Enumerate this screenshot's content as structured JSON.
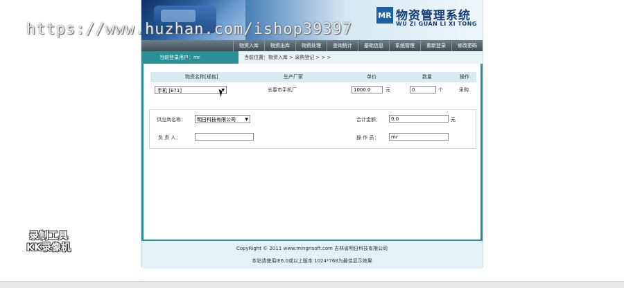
{
  "watermark": "https://www.huzhan.com/ishop39397",
  "recorder_badge": {
    "line1": "录制工具",
    "line2": "KK录像机"
  },
  "header": {
    "logo_mark": "MR",
    "title_cn": "物资管理系统",
    "title_en": "WU ZI GUAN LI XI TONG"
  },
  "nav": {
    "items": [
      "物资入库",
      "物资出库",
      "物资处理",
      "查询统计",
      "基础信息",
      "系统管理",
      "重新登录",
      "修改密码"
    ]
  },
  "infobar": {
    "current_user": "当前登录用户：mr",
    "location": "当前位置：物资入库 > 采购登记 > > >"
  },
  "table": {
    "headers": {
      "name": "物资名称[规格]",
      "factory": "生产厂家",
      "price": "单价",
      "qty": "数量",
      "op": "操作"
    },
    "row": {
      "name_select": "手机 [E71]",
      "factory": "长春市手机厂",
      "price": "1000.0",
      "price_unit": "元",
      "qty": "0",
      "qty_unit": "个",
      "op": "采购"
    }
  },
  "form": {
    "supplier_label": "供应商名称：",
    "supplier_value": "明日科技有限公司",
    "total_label": "合计金额：",
    "total_value": "0.0",
    "total_unit": "元",
    "manager_label": "负 责 人：",
    "manager_value": "",
    "operator_label": "操 作 员：",
    "operator_value": "mr"
  },
  "footer": {
    "copyright": "CopyRight © 2011 www.mingrisoft.com 吉林省明日科技有限公司",
    "note": "本站请使用IE6.0或以上版本 1024*768为最佳显示效果"
  },
  "colors": {
    "teal": "#2c8f95",
    "nav": "#4e5c63",
    "navy": "#133d75"
  }
}
